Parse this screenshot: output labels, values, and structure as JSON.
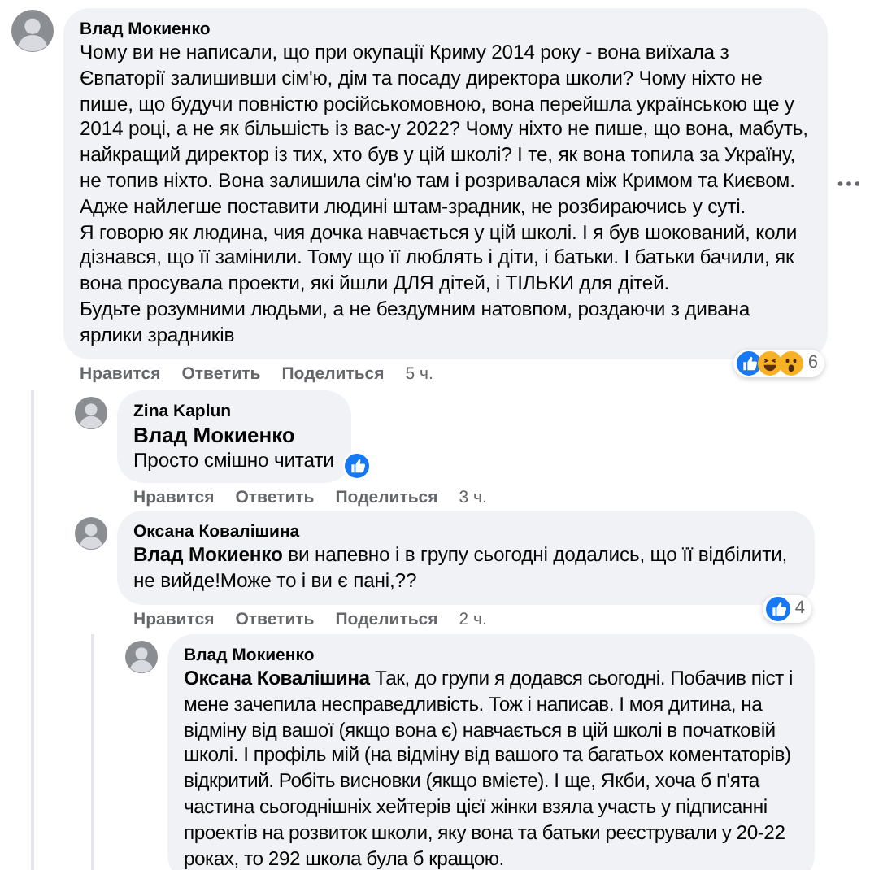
{
  "comments": [
    {
      "author": "Влад Мокиенко",
      "paragraphs": [
        "Чому ви не написали, що при окупації Криму 2014 року - вона виїхала з Євпаторії залишивши сім'ю, дім та посаду директора школи? Чому ніхто не пише, що будучи повністю російськомовною, вона перейшла українською ще у 2014 році, а не як більшість із вас-у 2022? Чому ніхто не пише, що вона, мабуть, найкращий директор із тих, хто був у цій школі? І те, як вона топила за Україну, не топив ніхто. Вона залишила сім'ю там і розривалася між Кримом та Києвом. Адже найлегше поставити людині штам-зрадник, не розбираючись у суті.",
        "Я говорю як людина, чия дочка навчається у цій школі. І я був шокований, коли дізнався, що її замінили. Тому що її люблять і діти, і батьки. І батьки бачили, як вона просувала проекти, які йшли ДЛЯ дітей, і ТІЛЬКИ для дітей.",
        "Будьте розумними людьми, а не бездумним натовпом, роздаючи з дивана ярлики зрадників"
      ],
      "reactions": {
        "icons": [
          {
            "kind": "like"
          },
          {
            "kind": "haha"
          },
          {
            "kind": "wow"
          }
        ],
        "count": "6"
      },
      "more_menu": true,
      "actions": [
        "Нравится",
        "Ответить",
        "Поделиться"
      ],
      "time": "5 ч.",
      "replies": [
        {
          "author": "Zina Kaplun",
          "mention": "Влад Мокиенко",
          "mention_break": true,
          "paragraphs": [
            "Просто смішно читати"
          ],
          "reactions": {
            "icons": [
              {
                "kind": "like"
              }
            ]
          },
          "actions": [
            "Нравится",
            "Ответить",
            "Поделиться"
          ],
          "time": "3 ч."
        },
        {
          "author": "Оксана Ковалішина",
          "mention": "Влад Мокиенко",
          "mention_break": false,
          "paragraphs": [
            "ви напевно і в групу сьогодні додались, що її відбілити, не вийде!Може то і ви є пані,??"
          ],
          "reactions": {
            "icons": [
              {
                "kind": "like"
              }
            ],
            "count": "4"
          },
          "actions": [
            "Нравится",
            "Ответить",
            "Поделиться"
          ],
          "time": "2 ч.",
          "replies": [
            {
              "author": "Влад Мокиенко",
              "mention": "Оксана Ковалішина",
              "mention_break": false,
              "paragraphs": [
                "Так, до групи я додався сьогодні. Побачив піст і мене зачепила несправедливість. Тож і написав. І моя дитина, на відміну від вашої (якщо вона є) навчається в цій школі в початковій школі. І профіль мій (на відміну від вашого та багатьох коментаторів) відкритий. Робіть висновки (якщо вмієте). І ще, Якби, хоча б п'ята частина сьогоднішніх хейтерів цієї жінки взяла участь у підписанні проектів на розвиток школи, яку вона та батьки реєстрували у 20-22 роках, то 292 школа була б кращою."
              ]
            }
          ]
        }
      ]
    }
  ]
}
